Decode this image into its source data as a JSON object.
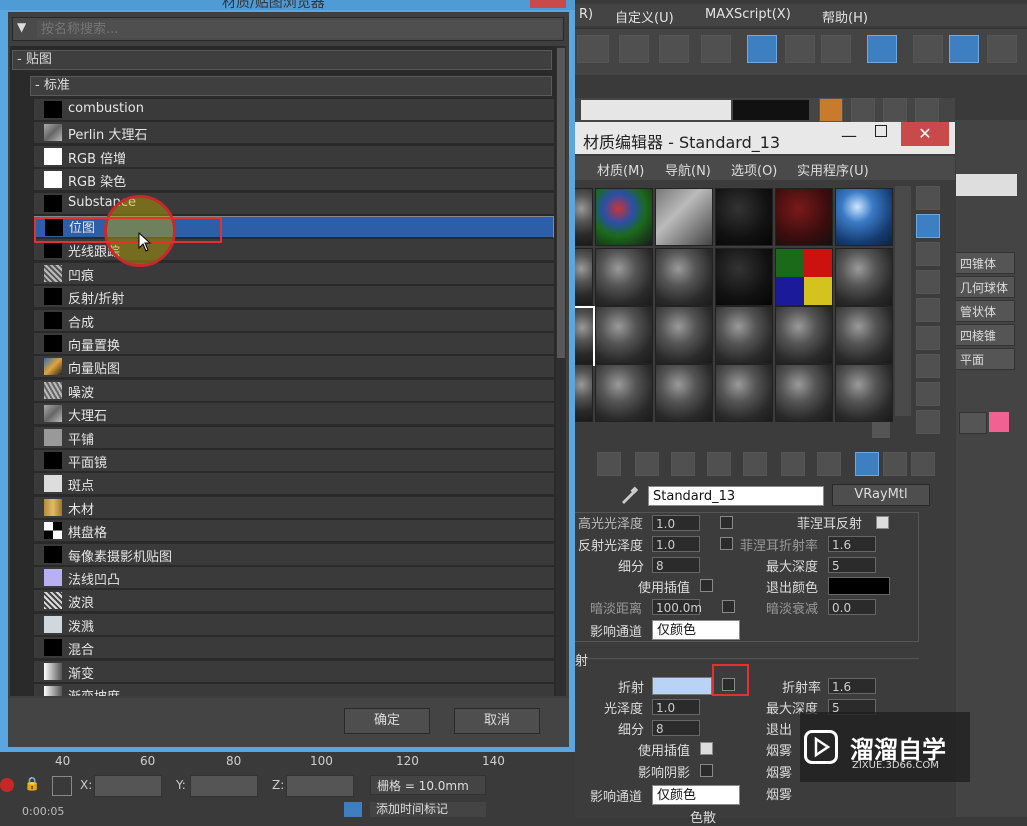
{
  "browser": {
    "title": "材质/贴图浏览器",
    "search_placeholder": "按名称搜索...",
    "group_maps": "- 贴图",
    "group_standard": "- 标准",
    "items": [
      {
        "label": "combustion",
        "icon": "black-swatch"
      },
      {
        "label": "Perlin 大理石",
        "icon": "marble-swatch"
      },
      {
        "label": "RGB 倍增",
        "icon": "white-swatch"
      },
      {
        "label": "RGB 染色",
        "icon": "white-swatch"
      },
      {
        "label": "Substance",
        "icon": "black-swatch"
      },
      {
        "label": "位图",
        "icon": "black-swatch"
      },
      {
        "label": "光线跟踪",
        "icon": "black-swatch"
      },
      {
        "label": "凹痕",
        "icon": "dent-swatch"
      },
      {
        "label": "反射/折射",
        "icon": "black-swatch"
      },
      {
        "label": "合成",
        "icon": "black-swatch"
      },
      {
        "label": "向量置换",
        "icon": "black-swatch"
      },
      {
        "label": "向量贴图",
        "icon": "vector-swatch"
      },
      {
        "label": "噪波",
        "icon": "noise-swatch"
      },
      {
        "label": "大理石",
        "icon": "marble-swatch"
      },
      {
        "label": "平铺",
        "icon": "tile-swatch"
      },
      {
        "label": "平面镜",
        "icon": "black-swatch"
      },
      {
        "label": "斑点",
        "icon": "speckle-swatch"
      },
      {
        "label": "木材",
        "icon": "wood-swatch"
      },
      {
        "label": "棋盘格",
        "icon": "checker-swatch"
      },
      {
        "label": "每像素摄影机贴图",
        "icon": "black-swatch"
      },
      {
        "label": "法线凹凸",
        "icon": "normal-swatch"
      },
      {
        "label": "波浪",
        "icon": "wave-swatch"
      },
      {
        "label": "泼溅",
        "icon": "splat-swatch"
      },
      {
        "label": "混合",
        "icon": "black-swatch"
      },
      {
        "label": "渐变",
        "icon": "gradient-swatch"
      },
      {
        "label": "渐变坡度",
        "icon": "gradient-swatch"
      }
    ],
    "selected_index": 5,
    "ok_label": "确定",
    "cancel_label": "取消"
  },
  "top_menu": [
    "R)",
    "自定义(U)",
    "MAXScript(X)",
    "帮助(H)"
  ],
  "material_editor": {
    "title": "材质编辑器 - Standard_13",
    "menu": [
      "材质(M)",
      "导航(N)",
      "选项(O)",
      "实用程序(U)"
    ],
    "material_name": "Standard_13",
    "material_type": "VRayMtl",
    "params": {
      "gloss_label": "高光光泽度",
      "gloss_value": "1.0",
      "fresnel_label": "菲涅耳反射",
      "refl_gloss_label": "反射光泽度",
      "refl_gloss_value": "1.0",
      "fresnel_ior_label": "菲涅耳折射率",
      "fresnel_ior_value": "1.6",
      "subdiv_label": "细分",
      "subdiv_value": "8",
      "max_depth_label": "最大深度",
      "max_depth_value": "5",
      "use_interp_label": "使用插值",
      "exit_color_label": "退出颜色",
      "dim_dist_label": "暗淡距离",
      "dim_dist_value": "100.0m",
      "dim_falloff_label": "暗淡衰减",
      "dim_falloff_value": "0.0",
      "affect_channel_label": "影响通道",
      "affect_channel_value": "仅颜色",
      "section_refraction": "射",
      "refract_label": "折射",
      "ior_label": "折射率",
      "ior_value": "1.6",
      "gloss2_label": "光泽度",
      "gloss2_value": "1.0",
      "max_depth2_label": "最大深度",
      "max_depth2_value": "5",
      "subdiv2_label": "细分",
      "subdiv2_value": "8",
      "exit2_label": "退出",
      "use_interp2_label": "使用插值",
      "fog_label": "烟雾",
      "affect_shadow_label": "影响阴影",
      "fog2_label": "烟雾",
      "affect_channel2_label": "影响通道",
      "affect_channel2_value": "仅颜色",
      "fog3_label": "烟雾",
      "dispersion_label": "色散"
    }
  },
  "side_panel": [
    "四锥体",
    "几何球体",
    "管状体",
    "四棱锥",
    "平面"
  ],
  "timeline": {
    "ticks": [
      "40",
      "60",
      "80",
      "100",
      "120",
      "140"
    ],
    "x_label": "X:",
    "y_label": "Y:",
    "z_label": "Z:",
    "grid_label": "栅格 = 10.0mm",
    "add_time_tag": "添加时间标记",
    "time_readout": "0:00:05"
  },
  "watermark": {
    "brand": "溜溜自学",
    "site": "ZIXUE.3D66.COM"
  },
  "colors": {
    "selection": "#2d5ea8",
    "dialog_border": "#5aa6e0",
    "highlight_red": "#e53030",
    "accent_pink": "#f06292"
  }
}
